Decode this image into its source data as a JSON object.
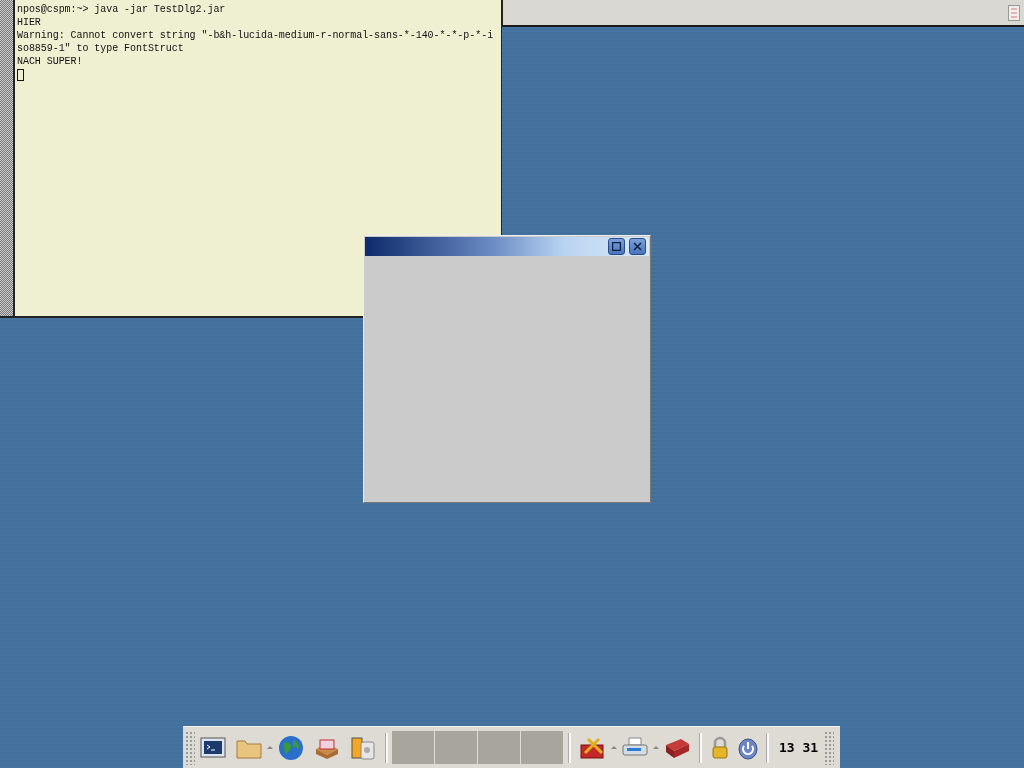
{
  "terminal": {
    "lines": [
      "npos@cspm:~> java -jar TestDlg2.jar",
      "HIER",
      "Warning: Cannot convert string \"-b&h-lucida-medium-r-normal-sans-*-140-*-*-p-*-i",
      "so8859-1\" to type FontStruct",
      "NACH SUPER!"
    ]
  },
  "dialog": {
    "buttons": [
      {
        "kind": "maximize"
      },
      {
        "kind": "close"
      }
    ]
  },
  "taskbar": {
    "launchers": [
      {
        "kind": "terminal",
        "menu": false
      },
      {
        "kind": "folder",
        "menu": true
      },
      {
        "kind": "globe",
        "menu": false
      },
      {
        "kind": "cardbox",
        "menu": false
      },
      {
        "kind": "film",
        "menu": false
      }
    ],
    "tray": [
      {
        "kind": "toolbox",
        "menu": true
      },
      {
        "kind": "printer",
        "menu": true
      },
      {
        "kind": "book",
        "menu": false
      }
    ],
    "system": [
      {
        "kind": "lock"
      },
      {
        "kind": "power"
      }
    ],
    "clock": "13 31"
  }
}
